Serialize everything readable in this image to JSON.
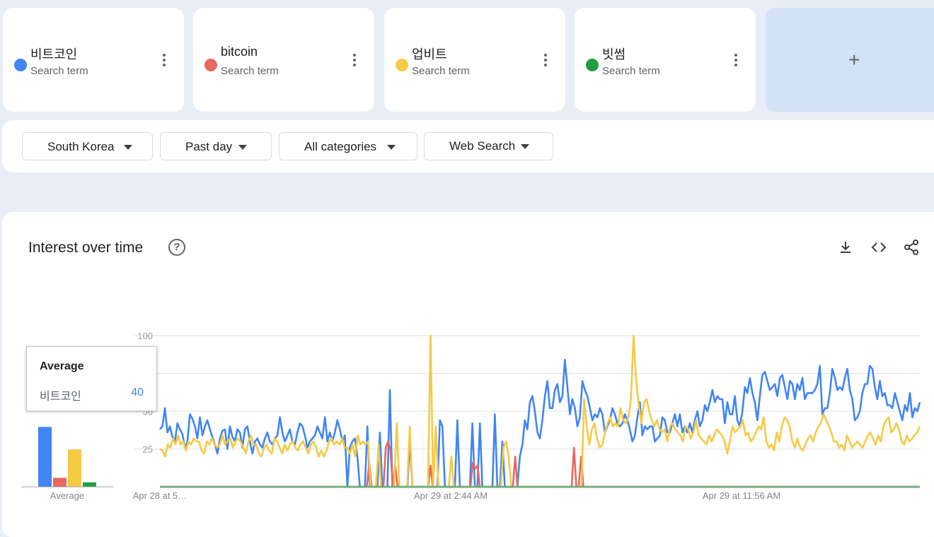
{
  "terms": [
    {
      "label": "비트코인",
      "sub": "Search term",
      "color": "#4285f4"
    },
    {
      "label": "bitcoin",
      "sub": "Search term",
      "color": "#e8675f"
    },
    {
      "label": "업비트",
      "sub": "Search term",
      "color": "#f5ca45"
    },
    {
      "label": "빗썸",
      "sub": "Search term",
      "color": "#1e9e3e"
    }
  ],
  "add_label": "+",
  "filters": {
    "region": "South Korea",
    "period": "Past day",
    "category": "All categories",
    "search_type": "Web Search"
  },
  "panel": {
    "title": "Interest over time",
    "help": "?"
  },
  "tooltip": {
    "title": "Average",
    "name": "비트코인",
    "value": "40"
  },
  "chart_data": {
    "type": "line",
    "title": "Interest over time",
    "x_labels": [
      "Apr 28 at 5…",
      "Apr 29 at 2:44 AM",
      "Apr 29 at 11:56 AM"
    ],
    "y_ticks": [
      "100",
      "75",
      "50",
      "25"
    ],
    "ylim": [
      0,
      100
    ],
    "grid": true,
    "averages": {
      "categories": [
        "비트코인",
        "bitcoin",
        "업비트",
        "빗썸"
      ],
      "values": [
        40,
        6,
        25,
        3
      ],
      "label": "Average"
    },
    "series": [
      {
        "name": "비트코인",
        "color": "#4285f4",
        "values": [
          38,
          40,
          52,
          36,
          40,
          33,
          30,
          42,
          38,
          35,
          26,
          30,
          48,
          45,
          40,
          32,
          46,
          34,
          40,
          44,
          38,
          33,
          28,
          22,
          32,
          37,
          38,
          25,
          40,
          33,
          30,
          38,
          36,
          26,
          38,
          40,
          30,
          22,
          30,
          32,
          28,
          26,
          32,
          36,
          30,
          28,
          32,
          34,
          46,
          36,
          30,
          34,
          38,
          30,
          28,
          36,
          42,
          40,
          34,
          26,
          30,
          32,
          34,
          40,
          36,
          32,
          46,
          30,
          36,
          30,
          36,
          44,
          38,
          30,
          34,
          0,
          26,
          30,
          32,
          20,
          0,
          0,
          0,
          40,
          0,
          0,
          0,
          0,
          36,
          0,
          0,
          0,
          64,
          0,
          0,
          0,
          0,
          0,
          0,
          0,
          30,
          0,
          0,
          0,
          0,
          0,
          0,
          0,
          0,
          0,
          0,
          0,
          44,
          40,
          0,
          0,
          0,
          0,
          0,
          44,
          0,
          0,
          0,
          0,
          0,
          42,
          0,
          0,
          42,
          0,
          0,
          0,
          0,
          0,
          48,
          0,
          0,
          30,
          0,
          0,
          0,
          0,
          0,
          0,
          20,
          28,
          44,
          38,
          56,
          60,
          50,
          36,
          32,
          44,
          60,
          70,
          52,
          52,
          64,
          68,
          56,
          60,
          84,
          66,
          48,
          58,
          52,
          40,
          46,
          70,
          64,
          60,
          52,
          44,
          48,
          46,
          52,
          48,
          36,
          40,
          44,
          52,
          48,
          42,
          40,
          42,
          48,
          44,
          38,
          30,
          34,
          46,
          56,
          34,
          40,
          38,
          40,
          40,
          30,
          32,
          34,
          46,
          44,
          36,
          36,
          42,
          48,
          40,
          48,
          36,
          40,
          36,
          42,
          36,
          44,
          50,
          40,
          44,
          54,
          50,
          56,
          64,
          56,
          60,
          58,
          58,
          42,
          56,
          48,
          48,
          60,
          44,
          40,
          50,
          66,
          62,
          72,
          62,
          56,
          44,
          60,
          74,
          76,
          70,
          64,
          66,
          68,
          60,
          72,
          74,
          66,
          58,
          70,
          68,
          58,
          68,
          64,
          72,
          58,
          62,
          62,
          62,
          64,
          68,
          80,
          48,
          52,
          52,
          62,
          78,
          72,
          64,
          66,
          64,
          72,
          78,
          64,
          58,
          44,
          46,
          50,
          62,
          68,
          68,
          80,
          78,
          66,
          58,
          70,
          60,
          62,
          54,
          54,
          52,
          62,
          56,
          50,
          44,
          54,
          50,
          62,
          46,
          52,
          50,
          56
        ]
      },
      {
        "name": "bitcoin",
        "color": "#e8675f",
        "values": [
          0,
          0,
          0,
          0,
          0,
          0,
          0,
          0,
          0,
          0,
          0,
          0,
          0,
          0,
          0,
          0,
          0,
          0,
          0,
          0,
          0,
          0,
          0,
          0,
          0,
          0,
          0,
          0,
          0,
          0,
          0,
          0,
          0,
          0,
          0,
          0,
          0,
          0,
          0,
          0,
          0,
          0,
          0,
          0,
          0,
          0,
          0,
          0,
          0,
          0,
          0,
          0,
          0,
          0,
          0,
          0,
          0,
          0,
          0,
          0,
          0,
          0,
          0,
          0,
          0,
          0,
          0,
          0,
          0,
          0,
          0,
          0,
          0,
          0,
          0,
          0,
          0,
          0,
          0,
          0,
          0,
          0,
          0,
          0,
          0,
          0,
          0,
          0,
          0,
          16,
          0,
          0,
          0,
          0,
          0,
          0,
          26,
          30,
          24,
          0,
          14,
          0,
          0,
          0,
          0,
          0,
          0,
          0,
          0,
          0,
          0,
          0,
          0,
          0,
          0,
          14,
          0,
          0,
          0,
          0,
          0,
          0,
          0,
          0,
          0,
          0,
          0,
          0,
          0,
          0,
          0,
          0,
          0,
          16,
          12,
          14,
          0,
          0,
          0,
          0,
          0,
          0,
          0,
          0,
          0,
          0,
          0,
          0,
          0,
          0,
          0,
          20,
          0,
          0,
          0,
          0,
          0,
          0,
          0,
          0,
          0,
          0,
          0,
          0,
          0,
          0,
          0,
          0,
          0,
          0,
          0,
          0,
          0,
          0,
          0,
          0,
          26,
          0,
          0,
          20,
          0,
          0,
          0,
          0,
          0,
          0,
          0,
          0,
          0,
          0,
          0,
          0,
          0,
          0,
          0,
          0,
          0,
          0,
          0,
          0,
          0,
          0,
          0,
          0,
          0,
          0,
          0,
          0,
          0,
          0,
          0,
          0,
          0,
          0,
          0,
          0,
          0,
          0,
          0,
          0,
          0,
          0,
          0,
          0,
          0,
          0,
          0,
          0,
          0,
          0,
          0,
          0,
          0,
          0,
          0,
          0,
          0,
          0,
          0,
          0,
          0,
          0,
          0,
          0,
          0,
          0,
          0,
          0,
          0,
          0,
          0,
          0,
          0,
          0,
          0,
          0,
          0,
          0,
          0,
          0,
          0,
          0,
          0,
          0,
          0,
          0,
          0,
          0,
          0,
          0,
          0,
          0,
          0,
          0,
          0,
          0,
          0,
          0,
          0,
          0,
          0,
          0,
          0,
          0,
          0,
          0,
          0,
          0,
          0,
          0,
          0,
          0,
          0,
          0,
          0,
          0,
          0,
          0,
          0,
          0,
          0,
          0,
          0,
          0,
          0,
          0,
          0,
          0,
          0,
          0,
          0,
          0,
          0,
          0,
          0,
          0,
          0,
          0,
          0,
          0,
          0,
          0,
          0,
          0
        ]
      },
      {
        "name": "업비트",
        "color": "#f5ca45",
        "values": [
          25,
          24,
          20,
          28,
          26,
          32,
          28,
          34,
          28,
          30,
          24,
          30,
          28,
          32,
          30,
          30,
          24,
          22,
          30,
          28,
          32,
          28,
          26,
          28,
          34,
          28,
          30,
          32,
          26,
          30,
          32,
          30,
          26,
          22,
          30,
          34,
          28,
          28,
          22,
          20,
          26,
          28,
          24,
          22,
          32,
          30,
          26,
          22,
          28,
          24,
          28,
          30,
          26,
          24,
          28,
          30,
          26,
          22,
          28,
          30,
          26,
          20,
          24,
          20,
          24,
          30,
          32,
          28,
          30,
          28,
          32,
          26,
          26,
          22,
          28,
          20,
          34,
          28,
          30,
          28,
          30,
          0,
          0,
          0,
          28,
          0,
          0,
          0,
          0,
          0,
          0,
          42,
          0,
          0,
          0,
          0,
          40,
          0,
          0,
          0,
          0,
          0,
          0,
          0,
          100,
          0,
          40,
          0,
          0,
          0,
          0,
          0,
          20,
          0,
          0,
          0,
          0,
          0,
          0,
          0,
          0,
          0,
          0,
          0,
          0,
          0,
          0,
          0,
          0,
          0,
          0,
          0,
          26,
          30,
          20,
          0,
          0,
          0,
          0,
          0,
          0,
          0,
          0,
          0,
          0,
          0,
          0,
          0,
          0,
          0,
          0,
          0,
          0,
          0,
          0,
          0,
          0,
          0,
          0,
          0,
          0,
          0,
          0,
          58,
          40,
          28,
          38,
          42,
          32,
          26,
          28,
          36,
          42,
          46,
          40,
          42,
          40,
          52,
          44,
          42,
          46,
          58,
          100,
          70,
          54,
          42,
          56,
          58,
          50,
          44,
          40,
          44,
          38,
          36,
          38,
          30,
          40,
          42,
          38,
          36,
          34,
          30,
          40,
          38,
          32,
          36,
          44,
          34,
          32,
          30,
          28,
          34,
          30,
          34,
          38,
          36,
          34,
          30,
          22,
          30,
          40,
          36,
          38,
          40,
          44,
          34,
          36,
          30,
          32,
          36,
          40,
          38,
          46,
          30,
          26,
          28,
          24,
          36,
          30,
          40,
          46,
          44,
          40,
          30,
          26,
          32,
          26,
          24,
          28,
          32,
          34,
          30,
          36,
          40,
          42,
          48,
          44,
          40,
          36,
          30,
          30,
          26,
          28,
          24,
          34,
          30,
          26,
          28,
          30,
          28,
          26,
          30,
          34,
          36,
          32,
          28,
          34,
          30,
          40,
          44,
          46,
          36,
          38,
          42,
          38,
          30,
          28,
          34,
          30,
          32,
          34,
          36,
          40
        ]
      },
      {
        "name": "빗썸",
        "color": "#1e9e3e",
        "values": [
          0,
          0,
          0,
          0,
          0,
          0,
          0,
          0,
          0,
          0,
          0,
          0,
          0,
          0,
          0,
          0,
          0,
          0,
          0,
          0,
          0,
          0,
          0,
          0,
          0,
          0,
          0,
          0,
          0,
          0,
          0,
          0,
          0,
          0,
          0,
          0,
          0,
          0,
          0,
          0,
          0,
          0,
          0,
          0,
          0,
          0,
          0,
          0,
          0,
          0,
          0,
          0,
          0,
          0,
          0,
          0,
          0,
          0,
          0,
          0,
          0,
          0,
          0,
          0,
          0,
          0,
          0,
          0,
          0,
          0,
          0,
          0,
          0,
          0,
          0,
          0,
          0,
          0,
          0,
          0,
          0,
          0,
          0,
          0,
          0,
          0,
          0,
          0,
          0,
          0,
          0,
          0,
          0,
          0,
          0,
          0,
          0,
          0,
          0,
          0,
          0,
          0,
          0,
          0,
          0,
          0,
          0,
          0,
          0,
          0,
          0,
          0,
          0,
          0,
          0,
          0,
          0,
          0,
          0,
          0,
          0,
          0,
          0,
          0,
          0,
          0,
          0,
          0,
          0,
          0,
          0,
          0,
          0,
          0,
          0,
          0,
          0,
          0,
          0,
          0,
          0,
          0,
          0,
          0,
          0,
          0,
          0,
          0,
          0,
          0,
          0,
          0,
          0,
          0,
          0,
          0,
          0,
          0,
          0,
          0,
          0,
          0,
          0,
          0,
          0,
          0,
          0,
          0,
          0,
          0,
          0,
          0,
          0,
          0,
          0,
          0,
          0,
          0,
          0,
          0,
          0,
          0,
          0,
          0,
          0,
          0,
          0,
          0,
          0,
          0,
          0,
          0,
          0,
          0,
          0,
          0,
          0,
          0,
          0,
          0,
          0,
          0,
          0,
          0,
          0,
          0,
          0,
          0,
          0,
          0,
          0,
          0,
          0,
          0,
          0,
          0,
          0,
          0,
          0,
          0,
          0,
          0,
          0,
          0,
          0,
          0,
          0,
          0,
          0,
          0,
          0,
          0,
          0,
          0,
          0,
          0,
          0,
          0,
          0,
          0,
          0,
          0,
          0,
          0,
          0,
          0,
          0,
          0,
          0,
          0,
          0,
          0,
          0,
          0,
          0,
          0,
          0,
          0,
          0,
          0,
          0,
          0,
          0,
          0,
          0,
          0,
          0,
          0,
          0,
          0,
          0,
          0,
          0,
          0,
          0,
          0,
          0,
          0,
          0,
          0,
          0,
          0,
          0,
          0,
          0,
          0,
          0,
          0,
          0,
          0,
          0,
          0,
          0,
          0,
          0,
          0,
          0,
          0,
          0,
          0,
          0
        ]
      }
    ]
  }
}
